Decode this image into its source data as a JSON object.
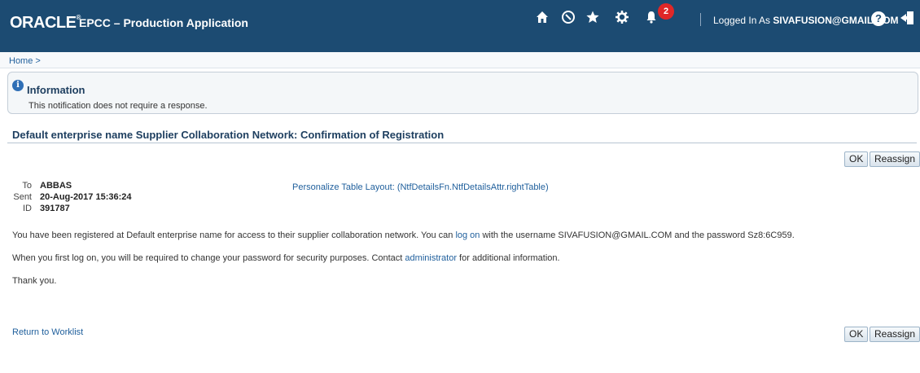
{
  "header": {
    "brand": "ORACLE",
    "trademark": "®",
    "app_title": "EPCC – Production Application",
    "notification_count": "2",
    "logged_in_prefix": "Logged In As",
    "logged_in_user": "SIVAFUSION@GMAIL.COM",
    "icons": [
      "home-icon",
      "compass-icon",
      "star-icon",
      "gear-icon",
      "bell-icon",
      "help-icon",
      "logout-icon"
    ]
  },
  "breadcrumb": {
    "home": "Home >"
  },
  "info": {
    "title": "Information",
    "message": "This notification does not require a response."
  },
  "page": {
    "heading": "Default enterprise name Supplier Collaboration Network: Confirmation of Registration"
  },
  "buttons": {
    "ok": "OK",
    "reassign": "Reassign"
  },
  "meta": {
    "to_label": "To",
    "to_value": "ABBAS",
    "sent_label": "Sent",
    "sent_value": "20-Aug-2017 15:36:24",
    "id_label": "ID",
    "id_value": "391787",
    "personalize": "Personalize Table Layout: (NtfDetailsFn.NtfDetailsAttr.rightTable)"
  },
  "message": {
    "line1_before": "You have been registered at Default enterprise name for access to their supplier collaboration network. You can ",
    "line1_link": "log on",
    "line1_after": " with the username SIVAFUSION@GMAIL.COM and the password Sz8:6C959.",
    "line2_before": "When you first log on, you will be required to change your password for security purposes. Contact ",
    "line2_link": "administrator",
    "line2_after": " for additional information.",
    "line3": "Thank you."
  },
  "footer": {
    "return_link": "Return to Worklist"
  },
  "colors": {
    "header_bg": "#1c4b72",
    "link": "#1f5f9c",
    "badge": "#e02727"
  }
}
